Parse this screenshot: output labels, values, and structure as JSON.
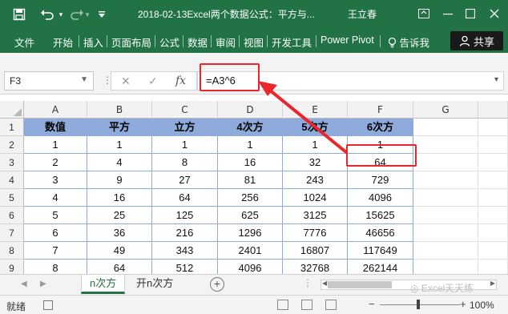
{
  "titlebar": {
    "title": "2018-02-13Excel两个数据公式：平方与...",
    "user": "王立春",
    "save_icon": "save-icon",
    "undo_icon": "undo-icon",
    "redo_icon": "redo-icon"
  },
  "ribbon": {
    "tabs": [
      "文件",
      "开始",
      "插入",
      "页面布局",
      "公式",
      "数据",
      "审阅",
      "视图",
      "开发工具",
      "Power Pivot"
    ],
    "tell_me": "告诉我",
    "share": "共享",
    "accent": "#217346"
  },
  "formula_bar": {
    "name_box": "F3",
    "fx_label": "fx",
    "formula": "=A3^6"
  },
  "grid": {
    "columns": [
      "A",
      "B",
      "C",
      "D",
      "E",
      "F",
      "G"
    ],
    "row_numbers": [
      "1",
      "2",
      "3",
      "4",
      "5",
      "6",
      "7",
      "8",
      "9"
    ],
    "header_row": [
      "数值",
      "平方",
      "立方",
      "4次方",
      "5次方",
      "6次方"
    ],
    "rows": [
      [
        "1",
        "1",
        "1",
        "1",
        "1",
        "1"
      ],
      [
        "2",
        "4",
        "8",
        "16",
        "32",
        "64"
      ],
      [
        "3",
        "9",
        "27",
        "81",
        "243",
        "729"
      ],
      [
        "4",
        "16",
        "64",
        "256",
        "1024",
        "4096"
      ],
      [
        "5",
        "25",
        "125",
        "625",
        "3125",
        "15625"
      ],
      [
        "6",
        "36",
        "216",
        "1296",
        "7776",
        "46656"
      ],
      [
        "7",
        "49",
        "343",
        "2401",
        "16807",
        "117649"
      ],
      [
        "8",
        "64",
        "512",
        "4096",
        "32768",
        "262144"
      ]
    ],
    "header_color": "#8eaadb",
    "highlight_color": "#e8262b"
  },
  "sheets": {
    "tabs": [
      "n次方",
      "开n次方"
    ],
    "active": "n次方"
  },
  "watermark": "Excel天天练",
  "status": {
    "ready": "就绪",
    "zoom": "100%"
  }
}
